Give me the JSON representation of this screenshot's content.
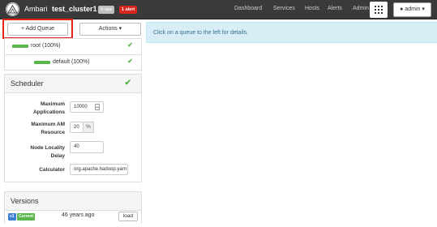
{
  "navbar": {
    "app_name": "Ambari",
    "cluster_name": "test_cluster1",
    "ops_badge": "0 ops",
    "alert_badge": "1 alert",
    "links": [
      "Dashboard",
      "Services",
      "Hosts",
      "Alerts",
      "Admin"
    ],
    "admin_label": "admin ▾",
    "grid_icon": "grid-icon"
  },
  "toolbar": {
    "add_queue_label": "+ Add Queue",
    "actions_label": "Actions ▾"
  },
  "queues": [
    {
      "label": "root (100%)",
      "status": "ok"
    },
    {
      "label": "default (100%)",
      "status": "ok"
    }
  ],
  "scheduler": {
    "title": "Scheduler",
    "status": "ok",
    "fields": {
      "max_apps_label": "Maximum Applications",
      "max_apps_value": "10000",
      "max_am_label": "Maximum AM Resource",
      "max_am_value": "20",
      "max_am_unit": "%",
      "node_locality_label": "Node Locality Delay",
      "node_locality_value": "40",
      "calculator_label": "Calculator",
      "calculator_value": "org.apache.hadoop.yarn"
    }
  },
  "versions": {
    "title": "Versions",
    "rows": [
      {
        "version": "v1",
        "tag": "Current",
        "time": "46 years ago",
        "action": "load"
      }
    ]
  },
  "info": {
    "message": "Click on a queue to the left for details."
  },
  "colors": {
    "navbar": "#3a3a3a",
    "success": "#5ab54b",
    "alert": "#d9261c",
    "info_bg": "#d9edf7",
    "highlight": "#e2231a"
  }
}
